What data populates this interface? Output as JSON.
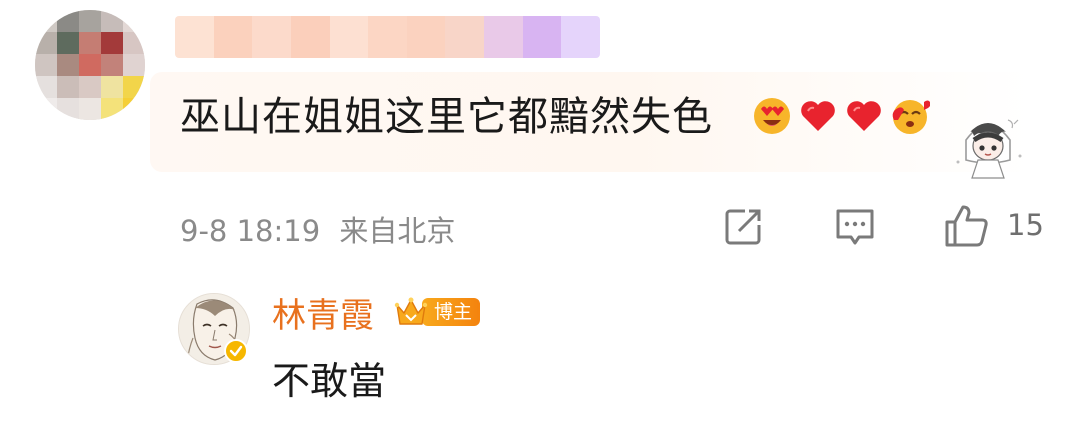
{
  "comment": {
    "avatar_icon": "blurred-avatar",
    "username_redacted": true,
    "text": "巫山在姐姐这里它都黯然失色",
    "emojis": [
      "heart-eyes-emoji",
      "red-heart-emoji",
      "red-heart-emoji",
      "blowing-kiss-emoji"
    ],
    "sticker_icon": "chibi-girl-sticker",
    "date": "9-8 18:19",
    "location": "来自北京",
    "actions": {
      "share_icon": "share-icon",
      "comment_icon": "comment-icon",
      "like_icon": "thumbs-up-icon",
      "like_count": "15"
    }
  },
  "reply": {
    "avatar_icon": "portrait-avatar",
    "verified_icon": "verified-badge-icon",
    "author": "林青霞",
    "badge_label": "博主",
    "text": "不敢當"
  },
  "colors": {
    "author_name": "#e8711e",
    "badge": "#f4830e",
    "meta_text": "#8a8a8a",
    "heart": "#e8232e"
  }
}
